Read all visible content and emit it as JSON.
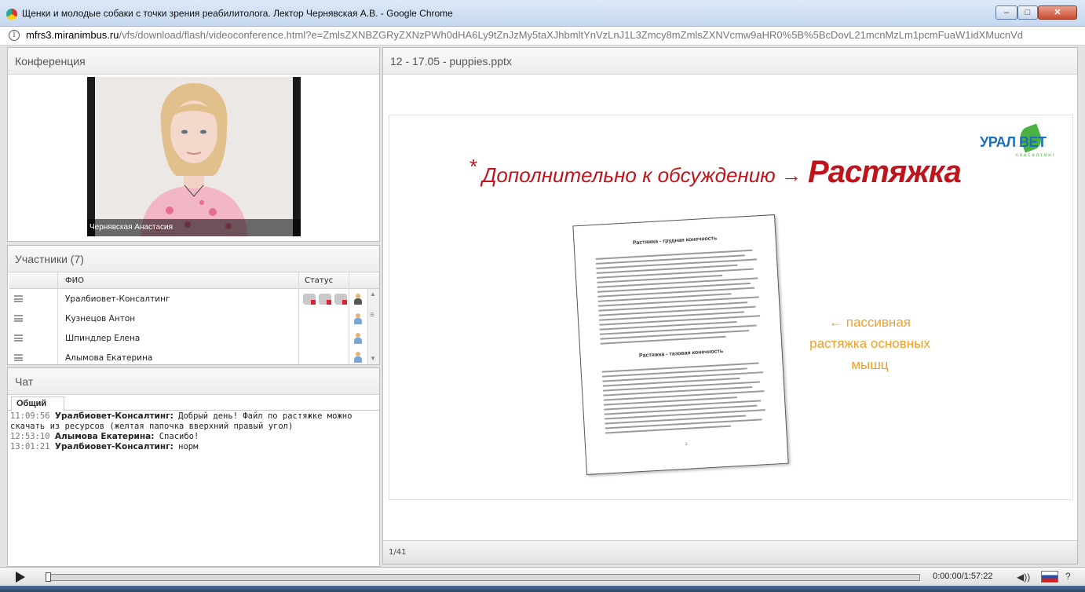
{
  "window": {
    "title": "Щенки и молодые собаки с точки зрения реабилитолога. Лектор Чернявская А.В. - Google Chrome",
    "min_glyph": "–",
    "max_glyph": "□",
    "close_glyph": "✕"
  },
  "address": {
    "host": "mfrs3.miranimbus.ru",
    "path": "/vfs/download/flash/videoconference.html?e=ZmlsZXNBZGRyZXNzPWh0dHA6Ly9tZnJzMy5taXJhbmltYnVzLnJ1L3Zmcy8mZmlsZXNVcmw9aHR0%5B%5BcDovL21mcnMzLm1pcmFuaW1idXMucnVd"
  },
  "conference": {
    "title": "Конференция",
    "speaker_name": "Чернявская Анастасия"
  },
  "participants": {
    "title": "Участники (7)",
    "col_name": "ФИО",
    "col_status": "Статус",
    "rows": [
      {
        "name": "Уралбиовет-Консалтинг",
        "role": "admin"
      },
      {
        "name": "Кузнецов Антон",
        "role": "user"
      },
      {
        "name": "Шпиндлер  Елена",
        "role": "user"
      },
      {
        "name": "Алымова Екатерина",
        "role": "user"
      }
    ]
  },
  "chat": {
    "title": "Чат",
    "tab": "Общий",
    "messages": [
      {
        "time": "11:09:56",
        "author": "Уралбиовет-Консалтинг:",
        "text": " Добрый день! Файл по растяжке можно скачать из ресурсов (желтая папочка вверхний правый угол)"
      },
      {
        "time": "12:53:10",
        "author": "Алымова Екатерина:",
        "text": " Спасибо!"
      },
      {
        "time": "13:01:21",
        "author": "Уралбиовет-Консалтинг:",
        "text": " норм"
      }
    ]
  },
  "presentation": {
    "title": "12 - 17.05 - puppies.pptx",
    "page": "1/41",
    "slide": {
      "logo_text": "УРАЛ ВЕТ",
      "logo_sub": "консалтинг",
      "asterisk": "*",
      "headline": "Дополнительно  к обсуждению →",
      "headline_bold": "Растяжка",
      "doc_title_1": "Растяжка  - грудная конечность",
      "doc_title_2": "Растяжка  - тазовая конечность",
      "doc_page": "1",
      "note_lines": [
        "← пассивная",
        "растяжка основных",
        "мышц"
      ]
    }
  },
  "player": {
    "time": "0:00:00/1:57:22",
    "help": "?",
    "volume_glyph": "◀))",
    "progress_fraction": 0.0
  },
  "colors": {
    "headline": "#c0141c",
    "note": "#f0a02a",
    "logo_blue": "#1f6fb8",
    "logo_green": "#4ab241"
  }
}
